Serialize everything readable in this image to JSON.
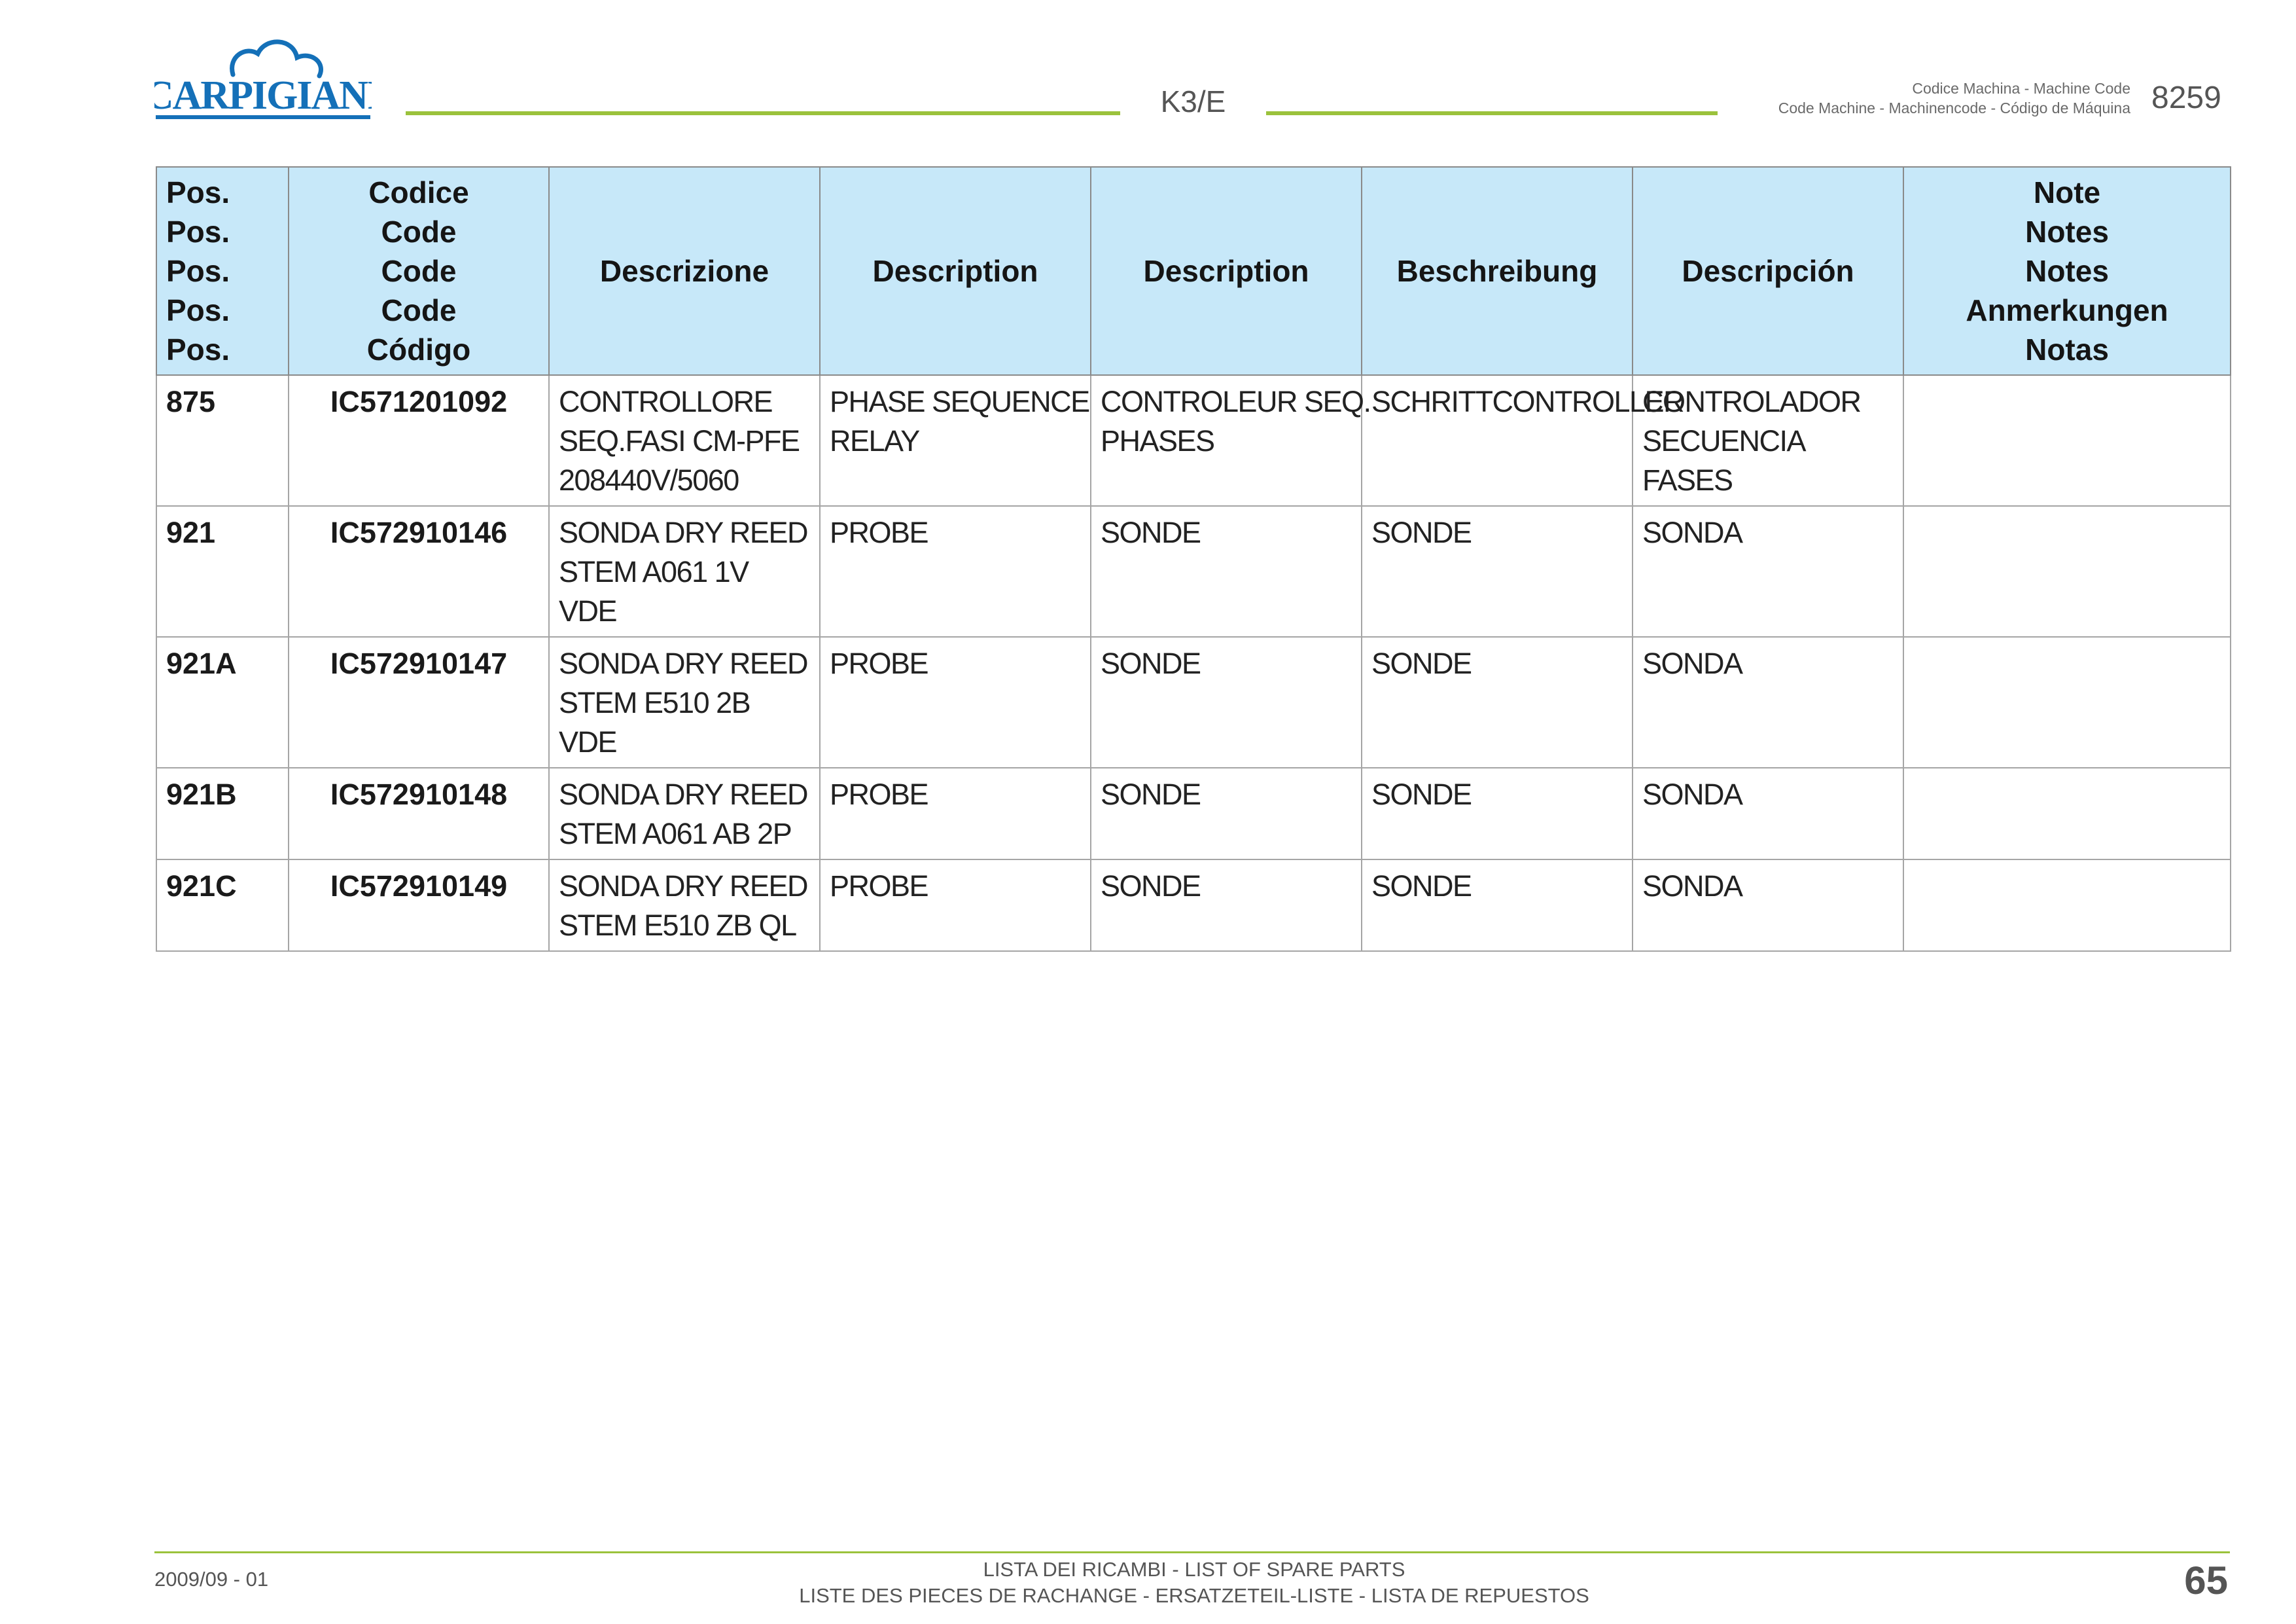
{
  "brand": {
    "logo_text": "CARPIGIANI",
    "blue": "#1470b8",
    "green": "#9bc23c"
  },
  "header": {
    "model": "K3/E",
    "machine_code_label_1": "Codice Machina - Machine Code",
    "machine_code_label_2": "Code Machine - Machinencode - Código de Máquina",
    "machine_code": "8259"
  },
  "table": {
    "header_bg": "#c7e8f9",
    "columns": [
      {
        "lines": [
          "Pos.",
          "Pos.",
          "Pos.",
          "Pos.",
          "Pos."
        ]
      },
      {
        "lines": [
          "Codice",
          "Code",
          "Code",
          "Code",
          "Código"
        ]
      },
      {
        "lines": [
          "Descrizione"
        ]
      },
      {
        "lines": [
          "Description"
        ]
      },
      {
        "lines": [
          "Description"
        ]
      },
      {
        "lines": [
          "Beschreibung"
        ]
      },
      {
        "lines": [
          "Descripción"
        ]
      },
      {
        "lines": [
          "Note",
          "Notes",
          "Notes",
          "Anmerkungen",
          "Notas"
        ]
      }
    ],
    "rows": [
      {
        "pos": "875",
        "code": "IC571201092",
        "it": [
          "CONTROLLORE",
          "SEQ.FASI CM-PFE",
          "208440V/5060"
        ],
        "en": [
          "PHASE SEQUENCE",
          "RELAY"
        ],
        "fr": [
          "CONTROLEUR SEQ.",
          "PHASES"
        ],
        "de": [
          "SCHRITTCONTROLLER"
        ],
        "es": [
          "CONTROLADOR",
          "SECUENCIA",
          "FASES"
        ],
        "note": ""
      },
      {
        "pos": "921",
        "code": "IC572910146",
        "it": [
          "SONDA DRY REED",
          "STEM A061 1V",
          "VDE"
        ],
        "en": [
          "PROBE"
        ],
        "fr": [
          "SONDE"
        ],
        "de": [
          "SONDE"
        ],
        "es": [
          "SONDA"
        ],
        "note": ""
      },
      {
        "pos": "921A",
        "code": "IC572910147",
        "it": [
          "SONDA DRY REED",
          "STEM E510 2B",
          "VDE"
        ],
        "en": [
          "PROBE"
        ],
        "fr": [
          "SONDE"
        ],
        "de": [
          "SONDE"
        ],
        "es": [
          "SONDA"
        ],
        "note": ""
      },
      {
        "pos": "921B",
        "code": "IC572910148",
        "it": [
          "SONDA DRY REED",
          "STEM A061 AB 2P"
        ],
        "en": [
          "PROBE"
        ],
        "fr": [
          "SONDE"
        ],
        "de": [
          "SONDE"
        ],
        "es": [
          "SONDA"
        ],
        "note": ""
      },
      {
        "pos": "921C",
        "code": "IC572910149",
        "it": [
          "SONDA DRY REED",
          "STEM E510 ZB QL"
        ],
        "en": [
          "PROBE"
        ],
        "fr": [
          "SONDE"
        ],
        "de": [
          "SONDE"
        ],
        "es": [
          "SONDA"
        ],
        "note": ""
      }
    ]
  },
  "footer": {
    "date": "2009/09 - 01",
    "title_1": "LISTA DEI RICAMBI - LIST OF SPARE PARTS",
    "title_2": "LISTE DES PIECES DE RACHANGE - ERSATZETEIL-LISTE - LISTA DE REPUESTOS",
    "page": "65"
  }
}
